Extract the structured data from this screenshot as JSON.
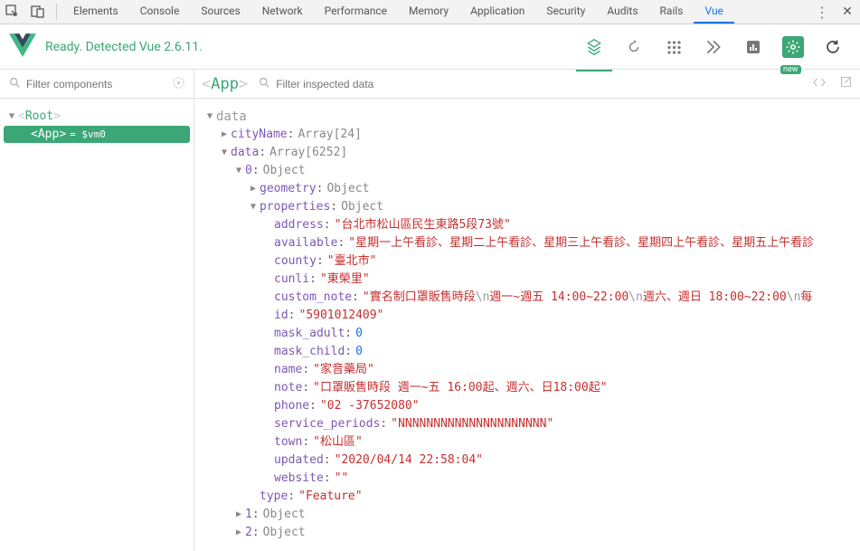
{
  "topTabs": [
    "Elements",
    "Console",
    "Sources",
    "Network",
    "Performance",
    "Memory",
    "Application",
    "Security",
    "Audits",
    "Rails",
    "Vue"
  ],
  "activeTab": "Vue",
  "vueStatus": "Ready. Detected Vue 2.6.11.",
  "badgeNew": "new",
  "filterComponentsPlaceholder": "Filter components",
  "filterInspectedPlaceholder": "Filter inspected data",
  "currentComponent": "App",
  "tree": {
    "root": "Root",
    "child": "App",
    "childSuffix": "= $vm0"
  },
  "inspector": {
    "sectionLabel": "data",
    "cityName": {
      "key": "cityName",
      "type": "Array[24]"
    },
    "dataArr": {
      "key": "data",
      "type": "Array[6252]"
    },
    "item0": {
      "key": "0",
      "type": "Object",
      "geometry": {
        "key": "geometry",
        "type": "Object"
      },
      "properties": {
        "key": "properties",
        "type": "Object",
        "address": {
          "key": "address",
          "value": "台北市松山區民生東路5段73號"
        },
        "available": {
          "key": "available",
          "value": "星期一上午看診、星期二上午看診、星期三上午看診、星期四上午看診、星期五上午看診"
        },
        "county": {
          "key": "county",
          "value": "臺北市"
        },
        "cunli": {
          "key": "cunli",
          "value": "東榮里"
        },
        "custom_note": {
          "key": "custom_note",
          "seg1": "實名制口罩販售時段",
          "esc1": "\\n",
          "seg2": "週一~週五 14:00~22:00",
          "esc2": "\\n",
          "seg3": "週六、週日 18:00~22:00",
          "esc3": "\\n",
          "seg4": "每"
        },
        "id": {
          "key": "id",
          "value": "5901012409"
        },
        "mask_adult": {
          "key": "mask_adult",
          "value": 0
        },
        "mask_child": {
          "key": "mask_child",
          "value": 0
        },
        "name": {
          "key": "name",
          "value": "家音藥局"
        },
        "note": {
          "key": "note",
          "value": "口罩販售時段 週一~五 16:00起、週六、日18:00起"
        },
        "phone": {
          "key": "phone",
          "value": "02 -37652080"
        },
        "service_periods": {
          "key": "service_periods",
          "value": "NNNNNNNNNNNNNNNNNNNNN"
        },
        "town": {
          "key": "town",
          "value": "松山區"
        },
        "updated": {
          "key": "updated",
          "value": "2020/04/14 22:58:04"
        },
        "website": {
          "key": "website",
          "value": ""
        }
      },
      "typeField": {
        "key": "type",
        "value": "Feature"
      }
    },
    "item1": {
      "key": "1",
      "type": "Object"
    },
    "item2": {
      "key": "2",
      "type": "Object"
    }
  }
}
